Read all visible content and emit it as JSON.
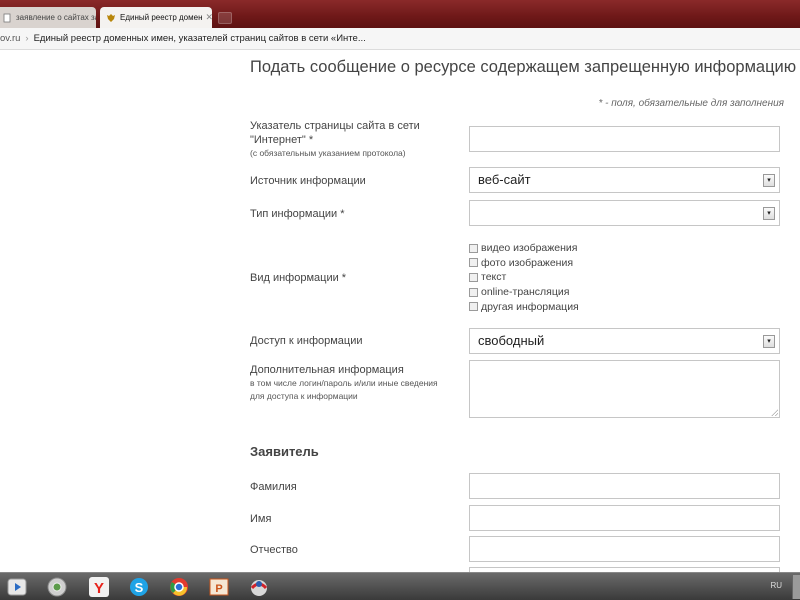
{
  "browser": {
    "tabs": [
      {
        "label": "заявление о сайтах за"
      },
      {
        "label": "Единый реестр домен",
        "close": "✕"
      }
    ],
    "address": {
      "domain": "ov.ru",
      "separator": "›",
      "title": "Единый реестр доменных имен, указателей страниц сайтов в сети «Инте..."
    }
  },
  "form": {
    "title": "Подать сообщение о ресурсе содержащем запрещенную информацию",
    "required_note": "* - поля, обязательные для заполнения",
    "url_label": "Указатель страницы сайта в сети \"Интернет\" *",
    "url_sublabel": "(с обязательным указанием протокола)",
    "source_label": "Источник информации",
    "source_value": "веб-сайт",
    "type_label": "Тип информации *",
    "type_value": "",
    "kind_label": "Вид информации *",
    "kind_options": [
      "видео изображения",
      "фото изображения",
      "текст",
      "online-трансляция",
      "другая информация"
    ],
    "access_label": "Доступ к информации",
    "access_value": "свободный",
    "extra_label": "Дополнительная информация",
    "extra_sublabel_1": "в том числе логин/пароль и/или иные сведения",
    "extra_sublabel_2": "для доступа к информации",
    "applicant_title": "Заявитель",
    "surname_label": "Фамилия",
    "name_label": "Имя",
    "patronymic_label": "Отчество"
  },
  "taskbar": {
    "language": "RU",
    "apps": [
      "media-player-icon",
      "chrome-like-icon",
      "yandex-browser-icon",
      "skype-icon",
      "chrome-icon",
      "powerpoint-icon",
      "app-icon"
    ]
  },
  "colors": {
    "tabstrip": "#6e1818",
    "text": "#444444",
    "field_border": "#c6c6c6"
  }
}
